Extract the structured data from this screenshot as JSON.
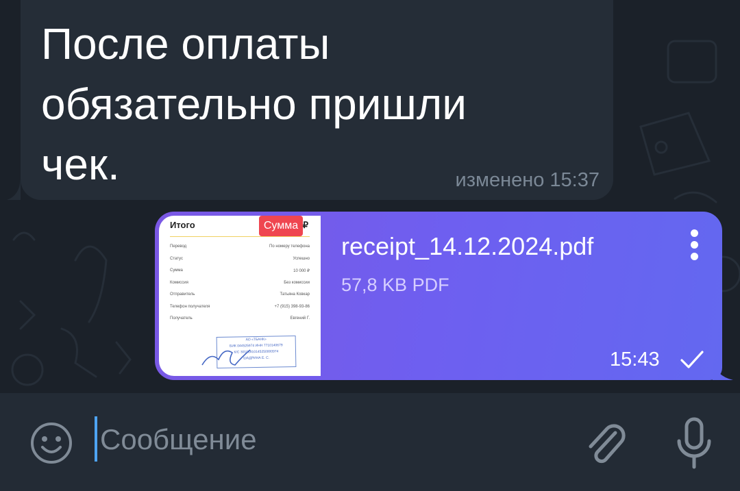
{
  "incoming_message": {
    "text": "После оплаты\nобязательно пришли\nчек.",
    "edited_time": "изменено 15:37"
  },
  "outgoing_file": {
    "file_name": "receipt_14.12.2024.pdf",
    "file_size": "57,8 KB PDF",
    "time": "15:43",
    "status_icon": "check-icon",
    "thumbnail": {
      "title": "Итого",
      "ruble": "₽",
      "badge": "Сумма",
      "rows": [
        {
          "label": "Перевод",
          "value": "По номеру телефона"
        },
        {
          "label": "Статус",
          "value": "Успешно"
        },
        {
          "label": "Сумма",
          "value": "10 000 ₽"
        },
        {
          "label": "Комиссия",
          "value": "Без комиссии"
        },
        {
          "label": "Отправитель",
          "value": "Татьяна Ковкар"
        },
        {
          "label": "Телефон получателя",
          "value": "+7 (915) 398-93-86"
        },
        {
          "label": "Получатель",
          "value": "Евгений Г."
        }
      ],
      "stamp": [
        "АО «ТБАНК»",
        "БИК 044525974 ИНН 7710140679",
        "К/С 30101810145250000974",
        "ШАДРИНА Е. С."
      ]
    }
  },
  "input_bar": {
    "placeholder": "Сообщение",
    "emoji_icon": "smile-icon",
    "attach_icon": "paperclip-icon",
    "mic_icon": "microphone-icon"
  },
  "colors": {
    "background": "#1b2129",
    "incoming_bubble": "#252d37",
    "outgoing_gradient_start": "#7a58e4",
    "outgoing_gradient_end": "#6368f0",
    "caret": "#4ea4f3",
    "badge": "#ef4650"
  }
}
